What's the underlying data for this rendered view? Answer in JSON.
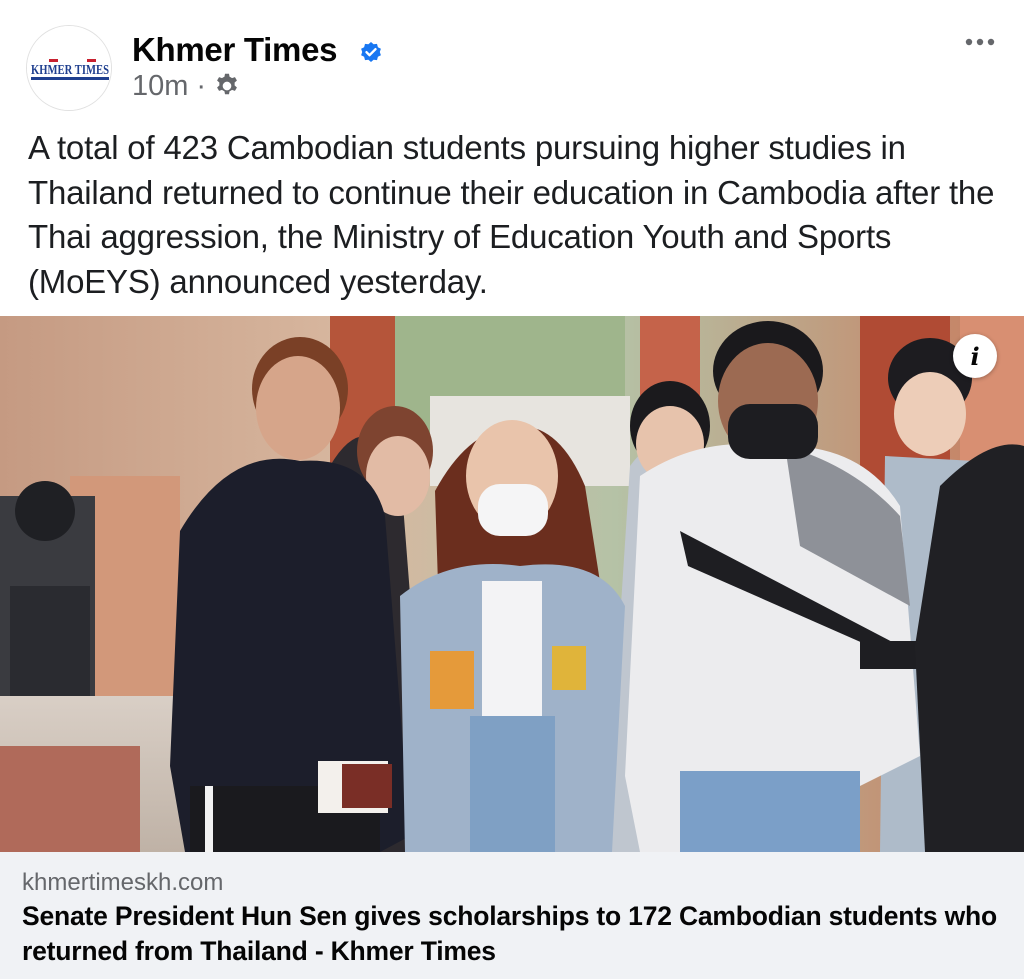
{
  "post": {
    "page_name": "Khmer Times",
    "timestamp": "10m",
    "separator": "·",
    "avatar_logo_text": "KHMER TIMES",
    "body_text": "A total of 423 Cambodian students pursuing higher studies in Thailand returned to continue their education in Cambodia after the Thai aggression, the Ministry of Education Youth and Sports (MoEYS) announced yesterday.",
    "icons": {
      "verified": "verified-badge-icon",
      "audience": "gear-icon",
      "more": "more-options-icon",
      "info": "info-icon"
    },
    "info_glyph": "i"
  },
  "link_preview": {
    "domain": "khmertimeskh.com",
    "title": "Senate President Hun Sen gives scholarships to 172 Cambodian students who returned from Thailand - Khmer Times"
  },
  "colors": {
    "verified_blue": "#1877f2",
    "secondary_text": "#65676b",
    "card_background": "#f0f2f5"
  }
}
